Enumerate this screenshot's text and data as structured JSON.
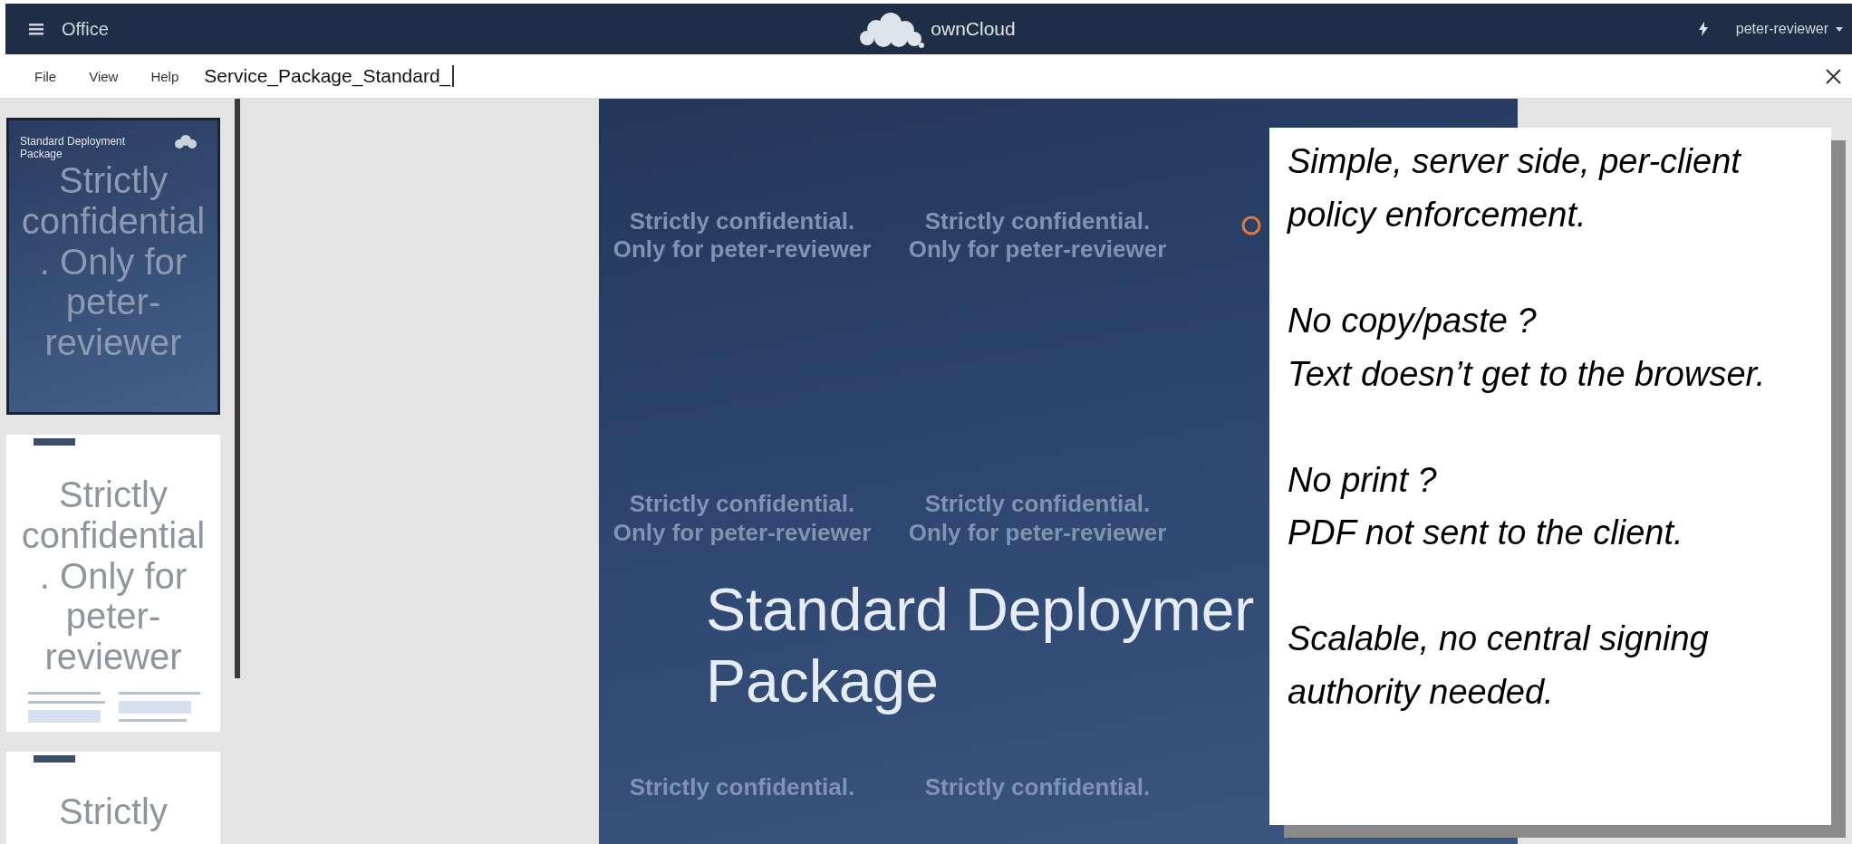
{
  "app_bar": {
    "app_name": "Office",
    "brand": "ownCloud",
    "user": "peter-reviewer"
  },
  "menu": [
    "File",
    "View",
    "Help"
  ],
  "document": {
    "file_name": "Service_Package_Standard_"
  },
  "thumbnails": [
    {
      "kind": "title",
      "selected": true,
      "title": "Standard Deployment Package",
      "watermark": "Strictly confidential. Only for peter-reviewer"
    },
    {
      "kind": "content",
      "selected": false,
      "watermark": "Strictly confidential. Only for peter-reviewer"
    },
    {
      "kind": "content",
      "selected": false,
      "watermark": "Strictly"
    }
  ],
  "slide": {
    "title_lines": [
      "Standard Deploymer",
      "Package"
    ],
    "watermarks": [
      [
        "Strictly confidential. Only for peter-reviewer",
        "Strictly confidential. Only for peter-reviewer"
      ],
      [
        "Strictly confidential. Only for peter-reviewer",
        "Strictly confidential. Only for peter-reviewer"
      ],
      [
        "Strictly confidential.",
        "Strictly confidential."
      ]
    ]
  },
  "callout": {
    "paragraphs": [
      [
        "Simple, server side, per-client policy enforcement."
      ],
      [
        "No copy/paste ?",
        "Text doesn’t get to the browser."
      ],
      [
        "No print ?",
        "PDF not sent to the client."
      ],
      [
        "Scalable, no central signing authority needed."
      ]
    ]
  }
}
